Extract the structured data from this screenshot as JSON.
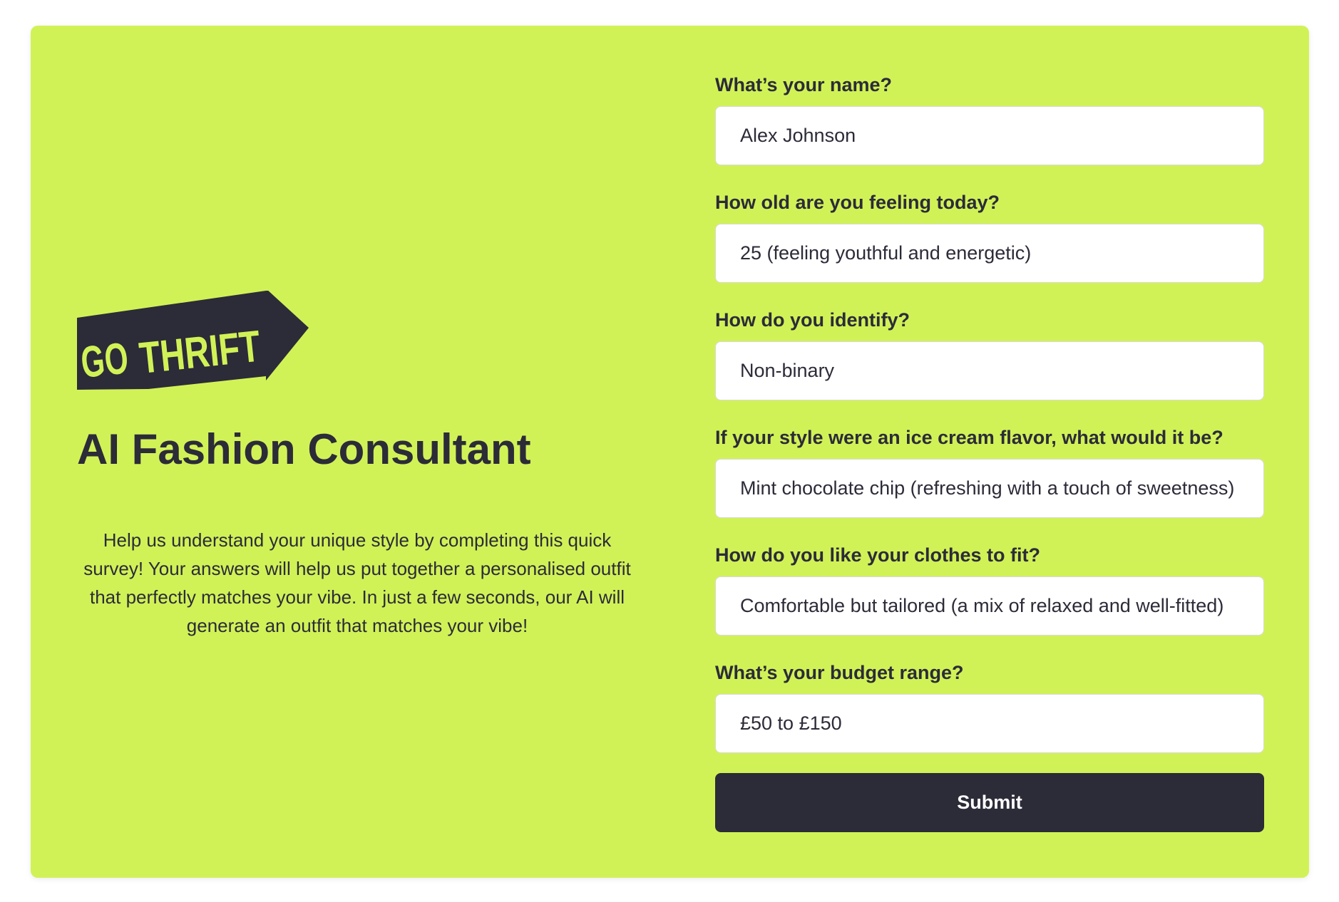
{
  "brand": {
    "logo_text_1": "GO",
    "logo_text_2": "THRIFT",
    "accent_color": "#d1f257",
    "dark_color": "#2c2b38"
  },
  "hero": {
    "title": "AI Fashion Consultant",
    "description": "Help us understand your unique style by completing this quick survey! Your answers will help us put together a personalised outfit that perfectly matches your vibe. In just a few seconds, our AI will generate an outfit that matches your vibe!"
  },
  "form": {
    "fields": [
      {
        "label": "What’s your name?",
        "value": "Alex Johnson"
      },
      {
        "label": "How old are you feeling today?",
        "value": "25 (feeling youthful and energetic)"
      },
      {
        "label": "How do you identify?",
        "value": "Non-binary"
      },
      {
        "label": "If your style were an ice cream flavor, what would it be?",
        "value": "Mint chocolate chip (refreshing with a touch of sweetness)"
      },
      {
        "label": "How do you like your clothes to fit?",
        "value": "Comfortable but tailored (a mix of relaxed and well-fitted)"
      },
      {
        "label": "What’s your budget range?",
        "value": "£50 to £150"
      }
    ],
    "submit_label": "Submit"
  }
}
